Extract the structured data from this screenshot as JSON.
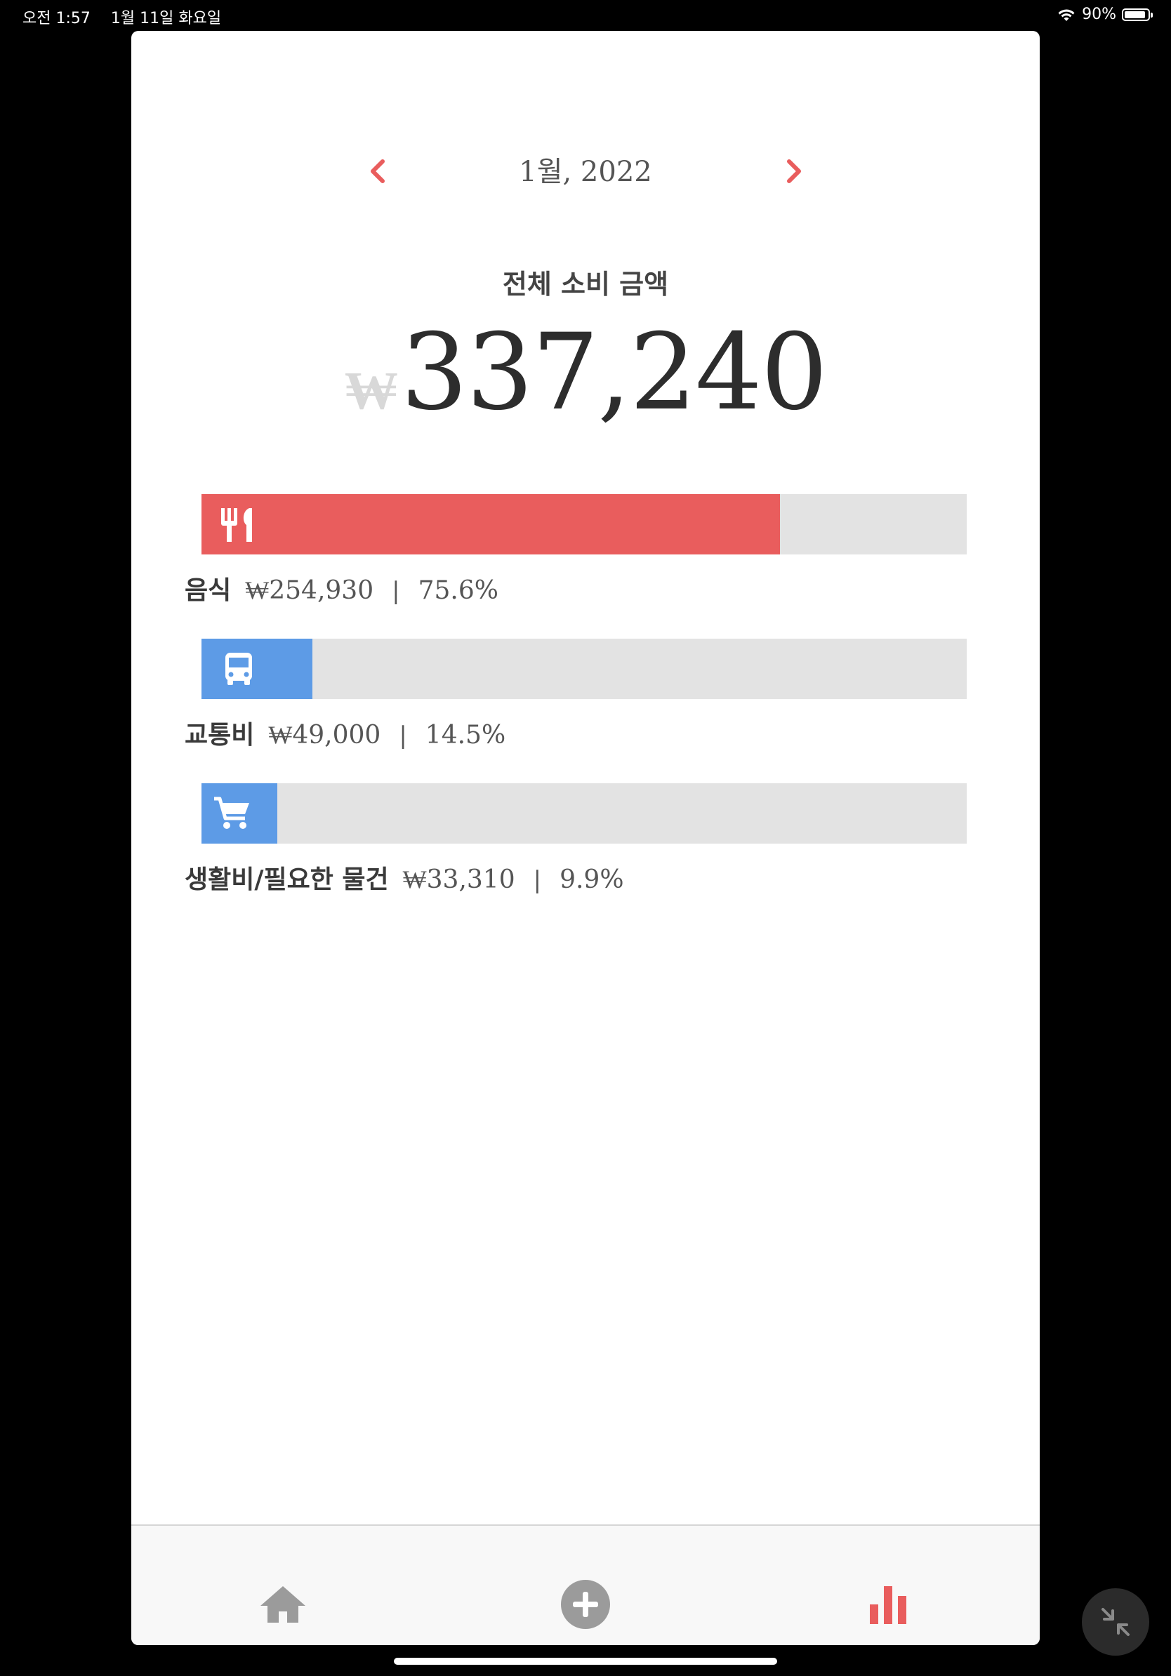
{
  "status_bar": {
    "time": "오전 1:57",
    "date": "1월 11일 화요일",
    "battery_percent": "90%",
    "battery_level": 0.9
  },
  "month_nav": {
    "label": "1월, 2022",
    "prev_icon": "chevron-left-icon",
    "next_icon": "chevron-right-icon"
  },
  "summary": {
    "title": "전체 소비 금액",
    "currency_symbol": "₩",
    "total": "337,240"
  },
  "categories": [
    {
      "name": "음식",
      "amount": "₩254,930",
      "separator": "|",
      "percent": "75.6%",
      "fraction": 0.756,
      "icon": "utensils-icon",
      "color": "#e95d5d"
    },
    {
      "name": "교통비",
      "amount": "₩49,000",
      "separator": "|",
      "percent": "14.5%",
      "fraction": 0.145,
      "icon": "bus-icon",
      "color": "#5d9be6"
    },
    {
      "name": "생활비/필요한 물건",
      "amount": "₩33,310",
      "separator": "|",
      "percent": "9.9%",
      "fraction": 0.099,
      "icon": "shopping-cart-icon",
      "color": "#5d9be6"
    }
  ],
  "tab_bar": {
    "tabs": [
      {
        "icon": "home-icon",
        "active": false
      },
      {
        "icon": "add-circle-icon",
        "active": false
      },
      {
        "icon": "bar-chart-icon",
        "active": true
      }
    ],
    "active_color": "#e95d5d",
    "inactive_color": "#9b9b9b"
  },
  "colors": {
    "accent": "#e95d5d",
    "secondary": "#5d9be6",
    "track": "#e3e3e3"
  }
}
